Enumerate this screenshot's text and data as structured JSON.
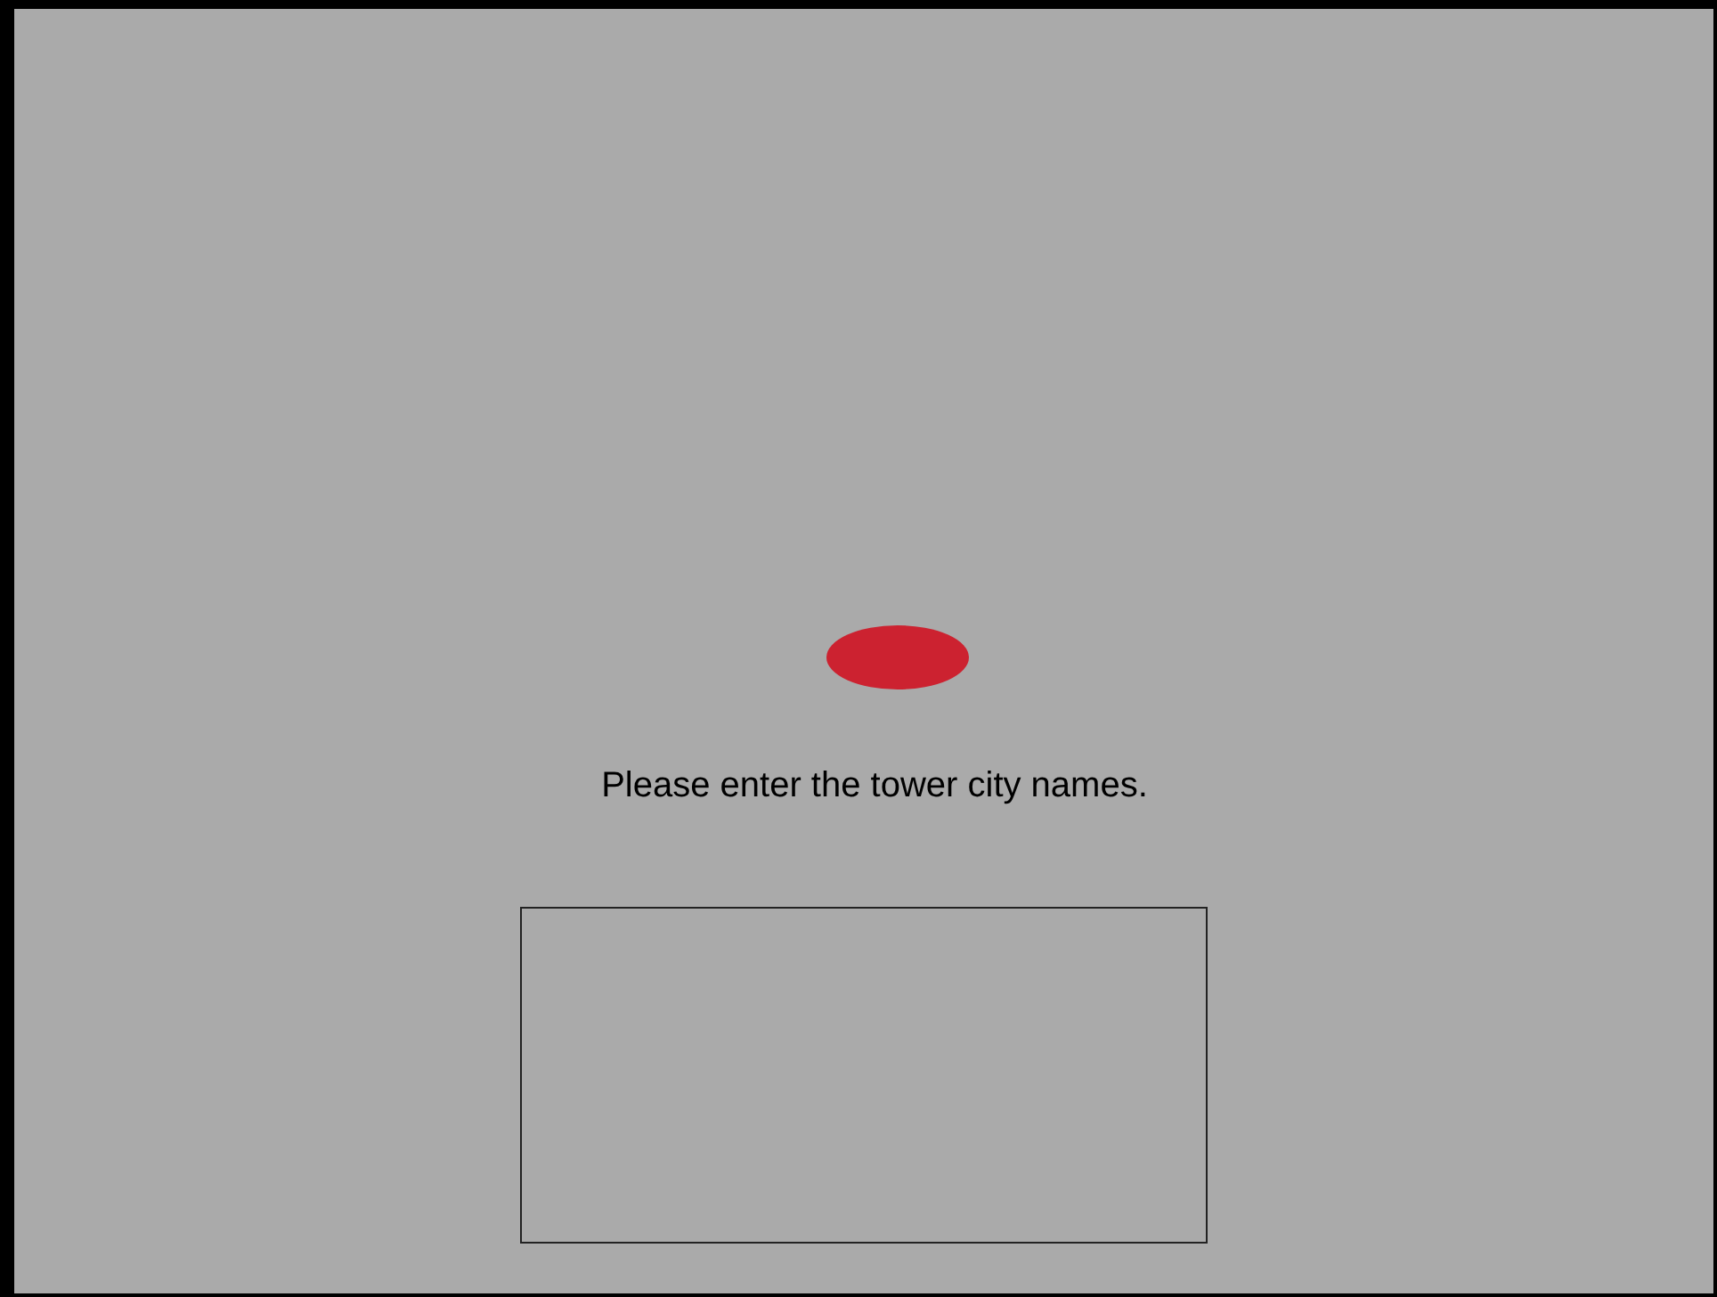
{
  "prompt": "Please enter the tower city names."
}
